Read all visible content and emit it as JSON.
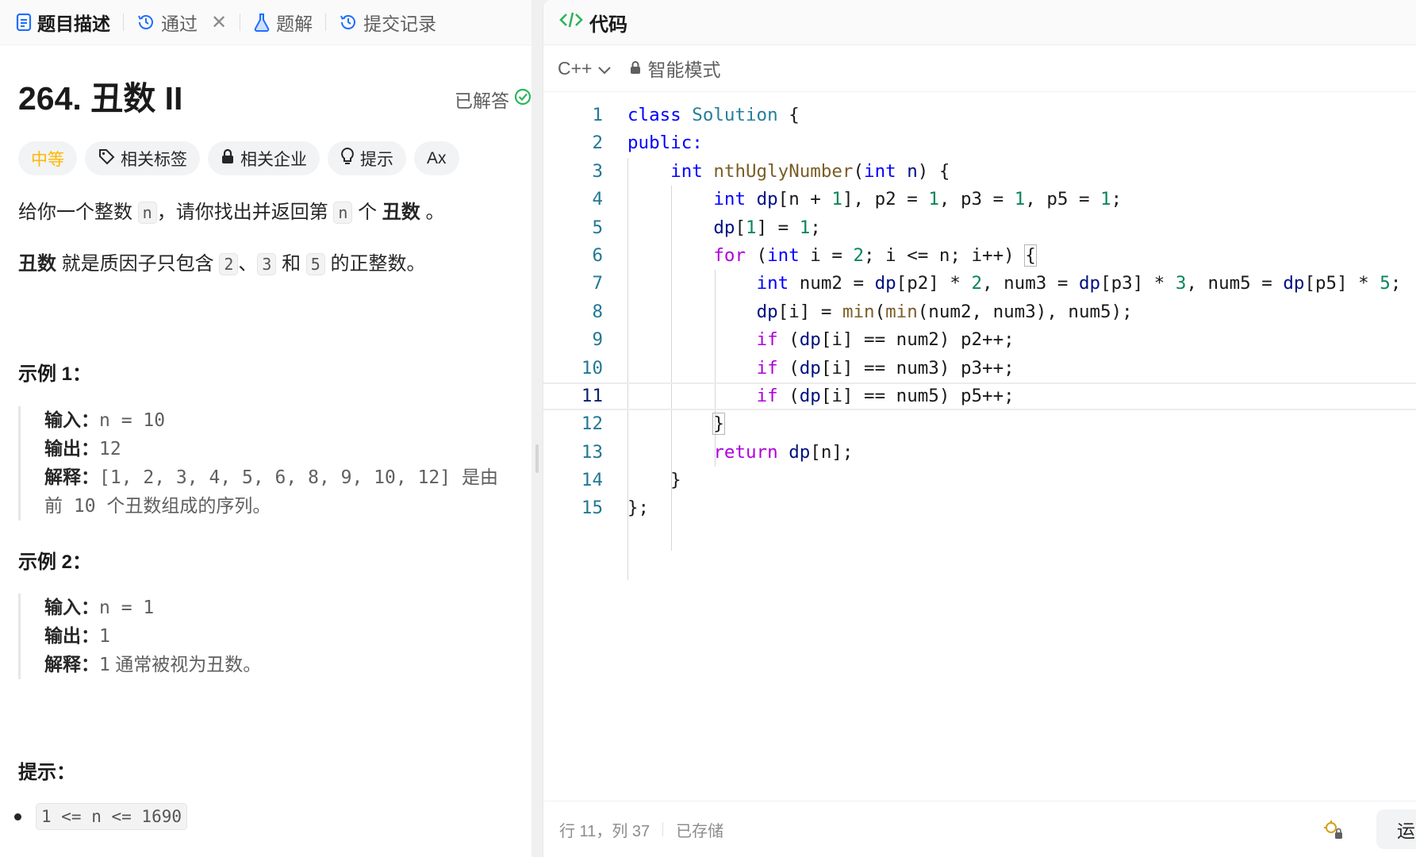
{
  "left_tabs": [
    {
      "label": "题目描述",
      "icon": "description-icon",
      "active": true
    },
    {
      "label": "通过",
      "icon": "history-icon",
      "closable": true
    },
    {
      "label": "题解",
      "icon": "flask-icon"
    },
    {
      "label": "提交记录",
      "icon": "history-icon"
    }
  ],
  "problem": {
    "title": "264. 丑数 II",
    "solved_label": "已解答",
    "difficulty": "中等",
    "chips": {
      "tags": "相关标签",
      "companies": "相关企业",
      "hint": "提示",
      "translate": "Ax"
    },
    "desc1": {
      "a": "给你一个整数",
      "n1": "n",
      "b": "，请你找出并返回第",
      "n2": "n",
      "c": "个",
      "bold": "丑数",
      "d": "。"
    },
    "desc2": {
      "bold": "丑数",
      "a": "就是质因子只包含",
      "v2": "2",
      "sep": "、",
      "v3": "3",
      "and": "和",
      "v5": "5",
      "b": "的正整数。"
    },
    "example1": {
      "title": "示例 1：",
      "input_label": "输入：",
      "input": "n = 10",
      "output_label": "输出：",
      "output": "12",
      "explain_label": "解释：",
      "explain_mono": "[1, 2, 3, 4, 5, 6, 8, 9, 10, 12]",
      "explain_text": " 是由",
      "explain_line2_a": "前",
      "explain_line2_num": " 10 ",
      "explain_line2_b": "个丑数组成的序列。"
    },
    "example2": {
      "title": "示例 2：",
      "input_label": "输入：",
      "input": "n = 1",
      "output_label": "输出：",
      "output": "1",
      "explain_label": "解释：",
      "explain_mono": "1",
      "explain_text": "通常被视为丑数。"
    },
    "hints_title": "提示：",
    "constraint": "1 <= n <= 1690"
  },
  "editor": {
    "header": "代码",
    "language": "C++",
    "mode": "智能模式",
    "line_numbers": [
      "1",
      "2",
      "3",
      "4",
      "5",
      "6",
      "7",
      "8",
      "9",
      "10",
      "11",
      "12",
      "13",
      "14",
      "15"
    ],
    "cursor_line": 11,
    "status": "行 11，列 37",
    "saved": "已存储",
    "run_label": "运"
  },
  "colors": {
    "accent_green": "#2db55d",
    "difficulty": "#ffb800",
    "keyword": "#0000ff",
    "control": "#af00db",
    "number": "#098658",
    "function": "#795e26"
  }
}
